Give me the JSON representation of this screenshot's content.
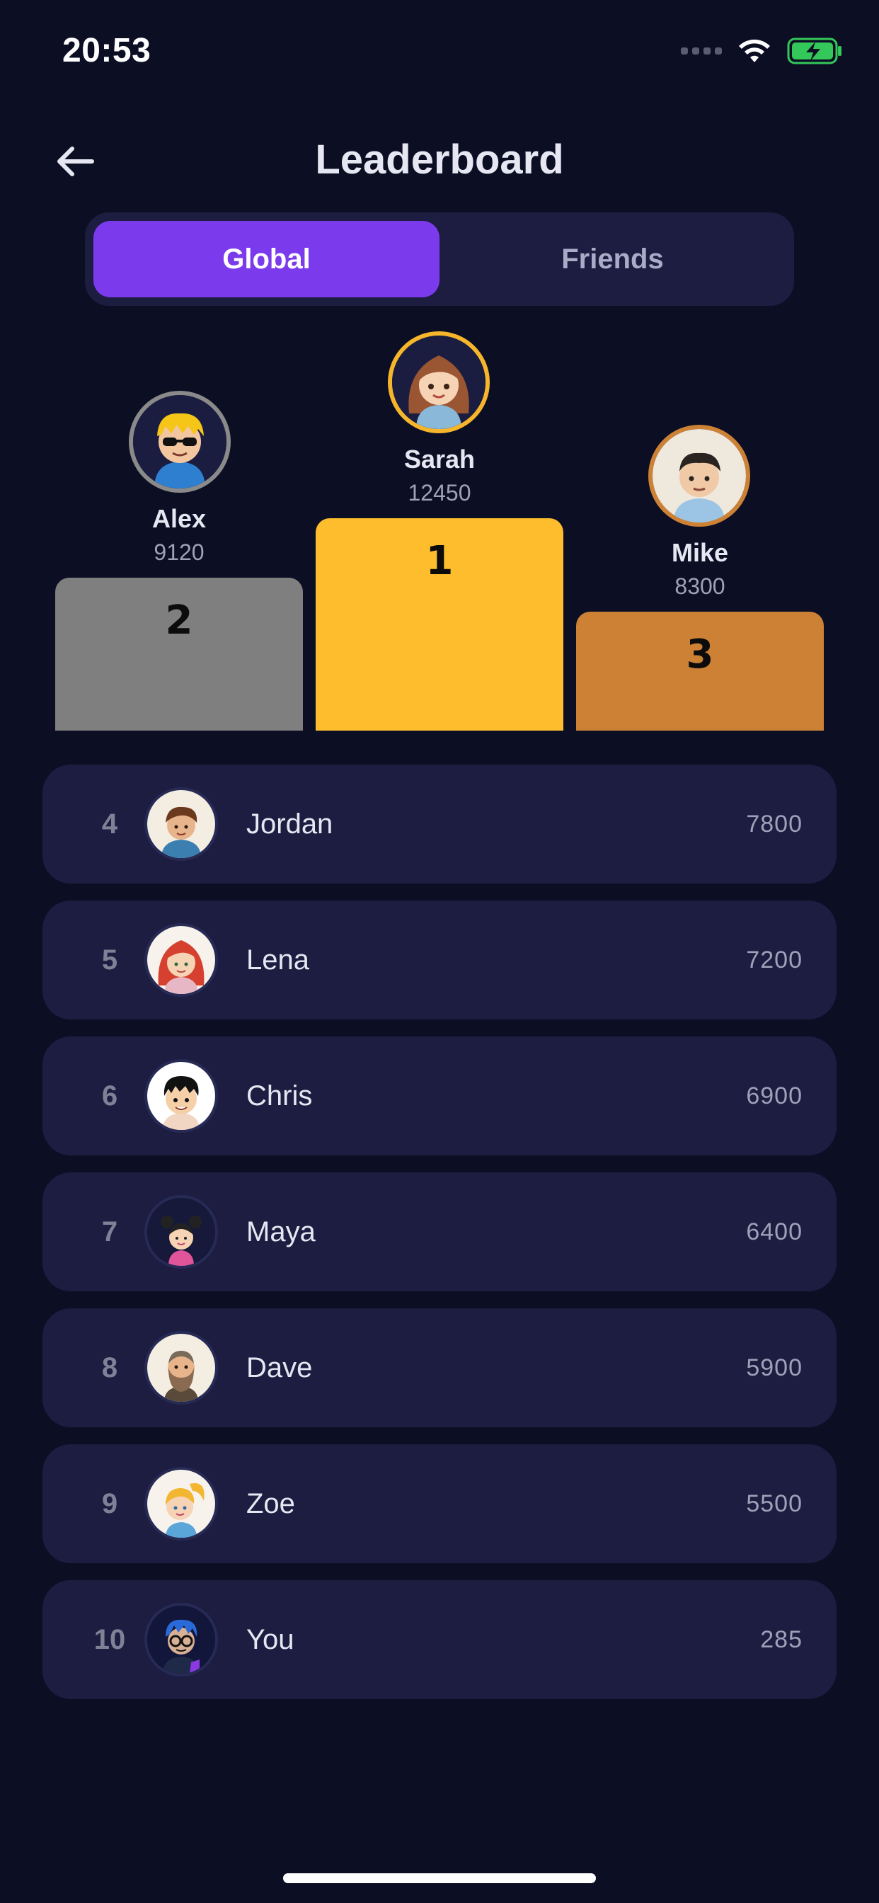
{
  "status_bar": {
    "time": "20:53"
  },
  "header": {
    "title": "Leaderboard",
    "back_icon": "arrow-left-icon"
  },
  "tabs": [
    {
      "label": "Global",
      "active": true
    },
    {
      "label": "Friends",
      "active": false
    }
  ],
  "podium": [
    {
      "rank": "2",
      "name": "Alex",
      "score": "9120",
      "color": "#7f7f7f",
      "ring": "#8a8a8a",
      "avatar_icon": "avatar-alex-icon"
    },
    {
      "rank": "1",
      "name": "Sarah",
      "score": "12450",
      "color": "#fdbd2d",
      "ring": "#f6b52a",
      "avatar_icon": "avatar-sarah-icon"
    },
    {
      "rank": "3",
      "name": "Mike",
      "score": "8300",
      "color": "#cd8135",
      "ring": "#cd8135",
      "avatar_icon": "avatar-mike-icon"
    }
  ],
  "list": [
    {
      "rank": "4",
      "name": "Jordan",
      "score": "7800"
    },
    {
      "rank": "5",
      "name": "Lena",
      "score": "7200"
    },
    {
      "rank": "6",
      "name": "Chris",
      "score": "6900"
    },
    {
      "rank": "7",
      "name": "Maya",
      "score": "6400"
    },
    {
      "rank": "8",
      "name": "Dave",
      "score": "5900"
    },
    {
      "rank": "9",
      "name": "Zoe",
      "score": "5500"
    },
    {
      "rank": "10",
      "name": "You",
      "score": "285"
    }
  ],
  "colors": {
    "accent": "#7c3aed",
    "background": "#0c0f24",
    "card": "#1c1d40"
  }
}
